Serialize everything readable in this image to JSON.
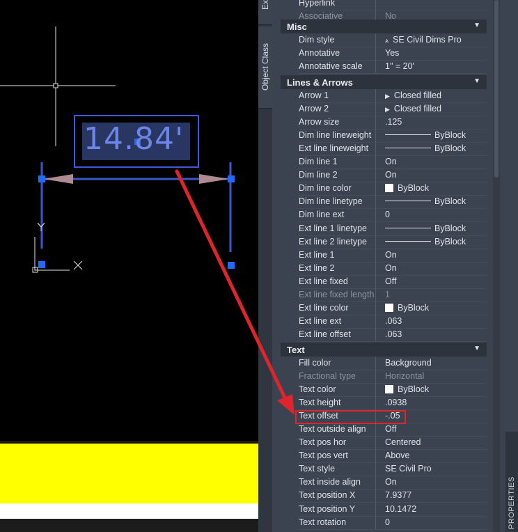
{
  "canvas": {
    "dimension_text": "14.84'"
  },
  "sidetabs": [
    {
      "label": "Ext"
    },
    {
      "label": "Object Class"
    }
  ],
  "panel": {
    "rows_top": [
      {
        "name": "Hyperlink",
        "value": ""
      },
      {
        "name": "Associative",
        "value": "No",
        "disabled": true
      }
    ],
    "misc": {
      "title": "Misc",
      "rows": [
        {
          "name": "Dim style",
          "value": "SE Civil Dims Pro",
          "icon": "dimstyle-icon"
        },
        {
          "name": "Annotative",
          "value": "Yes"
        },
        {
          "name": "Annotative scale",
          "value": "1\" = 20'"
        }
      ]
    },
    "lines_arrows": {
      "title": "Lines & Arrows",
      "rows": [
        {
          "name": "Arrow 1",
          "value": "Closed filled",
          "kind": "arrow"
        },
        {
          "name": "Arrow 2",
          "value": "Closed filled",
          "kind": "arrow"
        },
        {
          "name": "Arrow size",
          "value": ".125"
        },
        {
          "name": "Dim line lineweight",
          "value": "ByBlock",
          "kind": "line"
        },
        {
          "name": "Ext line lineweight",
          "value": "ByBlock",
          "kind": "line"
        },
        {
          "name": "Dim line 1",
          "value": "On"
        },
        {
          "name": "Dim line 2",
          "value": "On"
        },
        {
          "name": "Dim line color",
          "value": "ByBlock",
          "kind": "swatch"
        },
        {
          "name": "Dim line linetype",
          "value": "ByBlock",
          "kind": "line"
        },
        {
          "name": "Dim line ext",
          "value": "0"
        },
        {
          "name": "Ext line 1 linetype",
          "value": "ByBlock",
          "kind": "line"
        },
        {
          "name": "Ext line 2 linetype",
          "value": "ByBlock",
          "kind": "line"
        },
        {
          "name": "Ext line 1",
          "value": "On"
        },
        {
          "name": "Ext line 2",
          "value": "On"
        },
        {
          "name": "Ext line fixed",
          "value": "Off"
        },
        {
          "name": "Ext line fixed length",
          "value": "1",
          "disabled": true
        },
        {
          "name": "Ext line color",
          "value": "ByBlock",
          "kind": "swatch"
        },
        {
          "name": "Ext line ext",
          "value": ".063"
        },
        {
          "name": "Ext line offset",
          "value": ".063"
        }
      ]
    },
    "text": {
      "title": "Text",
      "rows": [
        {
          "name": "Fill color",
          "value": "Background"
        },
        {
          "name": "Fractional type",
          "value": "Horizontal",
          "disabled": true
        },
        {
          "name": "Text color",
          "value": "ByBlock",
          "kind": "swatch"
        },
        {
          "name": "Text height",
          "value": ".0938"
        },
        {
          "name": "Text offset",
          "value": "-.05",
          "highlighted": true
        },
        {
          "name": "Text outside align",
          "value": "Off"
        },
        {
          "name": "Text pos hor",
          "value": "Centered"
        },
        {
          "name": "Text pos vert",
          "value": "Above"
        },
        {
          "name": "Text style",
          "value": "SE Civil Pro"
        },
        {
          "name": "Text inside align",
          "value": "On"
        },
        {
          "name": "Text position X",
          "value": "7.9377"
        },
        {
          "name": "Text position Y",
          "value": "10.1472"
        },
        {
          "name": "Text rotation",
          "value": "0"
        }
      ]
    },
    "palette_tab": "PROPERTIES"
  },
  "colors": {
    "panel_bg": "#3b4350",
    "category_bg": "#2c333d",
    "highlight": "#e0242b",
    "canvas_yellow": "#ffff00",
    "dim_blue": "#2a61ff"
  }
}
